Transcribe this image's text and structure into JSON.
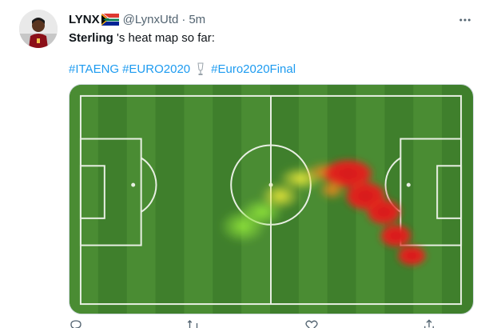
{
  "author": {
    "display_name": "LYNX",
    "handle": "@LynxUtd",
    "separator": "·",
    "time": "5m",
    "avatar_icon": "player-avatar",
    "flag_icon": "south-africa-flag-icon"
  },
  "tweet": {
    "text_bold": "Sterling",
    "text_rest": " 's heat map so far:",
    "hashtags": [
      "#ITAENG",
      "#EURO2020",
      "#Euro2020Final"
    ],
    "trophy_icon": "trophy-icon"
  },
  "media": {
    "description_icon": "football-pitch-heatmap",
    "pitch_color": "#3e7d2b",
    "heat_colors": [
      "#d91f1f",
      "#f0a21e",
      "#c7e835",
      "#5fcf2e"
    ]
  },
  "actions": [
    "reply-icon",
    "retweet-icon",
    "like-icon",
    "share-icon"
  ],
  "colors": {
    "link": "#1d9bf0",
    "muted": "#536471",
    "text": "#0f1419"
  }
}
